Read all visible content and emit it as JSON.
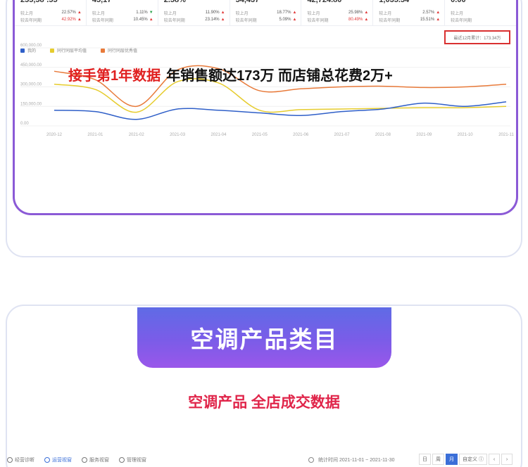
{
  "metrics": [
    {
      "value": "255,58·.55",
      "r1_label": "较上月",
      "r1_pct": "22.57%",
      "r1_dir": "up",
      "r2_label": "较去年同期",
      "r2_pct": "42.92%",
      "r2_red": true,
      "r2_dir": "up"
    },
    {
      "value": "45,17·",
      "r1_label": "较上月",
      "r1_pct": "1.11%",
      "r1_dir": "down",
      "r2_label": "较去年同期",
      "r2_pct": "10.45%",
      "r2_red": false,
      "r2_dir": "up"
    },
    {
      "value": "2.58%",
      "r1_label": "较上月",
      "r1_pct": "11.90%",
      "r1_dir": "up",
      "r2_label": "较去年同期",
      "r2_pct": "23.14%",
      "r2_red": false,
      "r2_dir": "up"
    },
    {
      "value": "54,437",
      "r1_label": "较上月",
      "r1_pct": "18.77%",
      "r1_dir": "up",
      "r2_label": "较去年同期",
      "r2_pct": "5.09%",
      "r2_red": false,
      "r2_dir": "up"
    },
    {
      "value": "42,724.80",
      "r1_label": "较上月",
      "r1_pct": "25.98%",
      "r1_dir": "up",
      "r2_label": "较去年同期",
      "r2_pct": "80.49%",
      "r2_red": true,
      "r2_dir": "up"
    },
    {
      "value": "1,035.54",
      "r1_label": "较上月",
      "r1_pct": "2.57%",
      "r1_dir": "up",
      "r2_label": "较去年同期",
      "r2_pct": "15.51%",
      "r2_red": false,
      "r2_dir": "up"
    },
    {
      "value": "0.00",
      "r1_label": "较上月",
      "r1_pct": "",
      "r1_dir": "",
      "r2_label": "较去年同期",
      "r2_pct": "",
      "r2_red": false,
      "r2_dir": ""
    }
  ],
  "summary": "最近12月累计：173.34万",
  "legend": [
    {
      "label": "我的",
      "color": "#2f5fc8"
    },
    {
      "label": "同行同层平均值",
      "color": "#e6cc2e"
    },
    {
      "label": "同行同层优秀值",
      "color": "#e87a3a"
    }
  ],
  "headline": {
    "red": "接手第1年数据",
    "dark": "年销售额达173万  而店铺总花费2万+"
  },
  "chart_data": {
    "type": "line",
    "x": [
      "2020-12",
      "2021-01",
      "2021-02",
      "2021-03",
      "2021-04",
      "2021-05",
      "2021-06",
      "2021-07",
      "2021-08",
      "2021-09",
      "2021-10",
      "2021-11"
    ],
    "y_ticks": [
      "600,000.00",
      "450,000.00",
      "300,000.00",
      "150,000.00",
      "0.00"
    ],
    "ylim": [
      0,
      600000
    ],
    "series": [
      {
        "name": "我的",
        "color": "#2f5fc8",
        "values": [
          120000,
          110000,
          50000,
          130000,
          120000,
          100000,
          80000,
          110000,
          130000,
          175000,
          150000,
          185000
        ]
      },
      {
        "name": "同行同层平均值",
        "color": "#e6cc2e",
        "values": [
          320000,
          280000,
          105000,
          340000,
          330000,
          120000,
          125000,
          130000,
          135000,
          140000,
          140000,
          150000
        ]
      },
      {
        "name": "同行同层优秀值",
        "color": "#e87a3a",
        "values": [
          420000,
          355000,
          150000,
          430000,
          440000,
          270000,
          285000,
          300000,
          305000,
          295000,
          300000,
          320000
        ]
      }
    ]
  },
  "banner": {
    "title": "空调产品类目"
  },
  "sub_headline": "空调产品 全店成交数据",
  "bottom_bar": {
    "tabs": [
      {
        "label": "经营诊断",
        "active": false
      },
      {
        "label": "运营视窗",
        "active": true
      },
      {
        "label": "服务视窗",
        "active": false
      },
      {
        "label": "管理视窗",
        "active": false
      }
    ],
    "time_label": "统计时间 2021-11-01 ~ 2021-11-30",
    "period_day": "日",
    "period_week": "周",
    "period_month": "月",
    "period_custom": "自定义 ⓘ",
    "prev": "‹",
    "next": "›"
  }
}
